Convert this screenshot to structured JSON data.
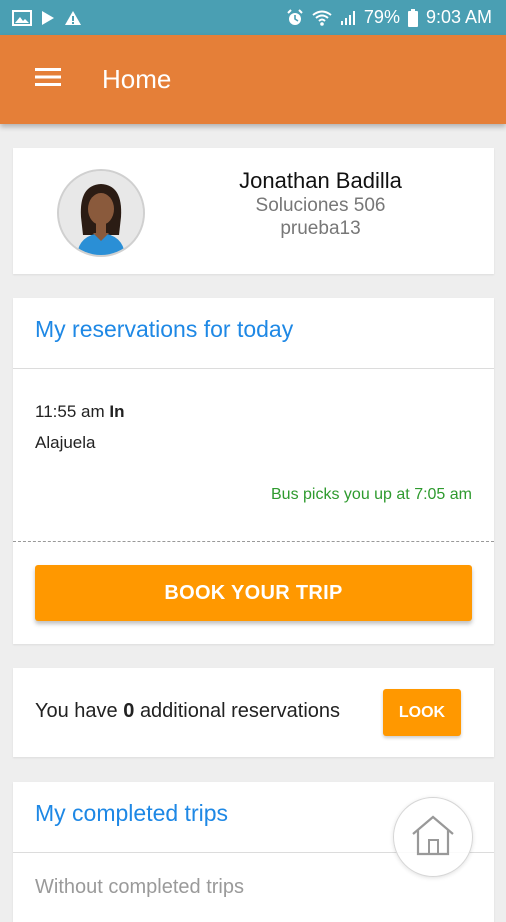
{
  "status_bar": {
    "battery": "79%",
    "time": "9:03 AM",
    "icons_left": [
      "gallery-icon",
      "play-store-icon",
      "warning-icon"
    ],
    "icons_right": [
      "alarm-icon",
      "wifi-icon",
      "signal-icon",
      "battery-icon"
    ],
    "color": "#4a9fb3"
  },
  "app_bar": {
    "title": "Home",
    "color": "#e57f38",
    "menu_icon": "hamburger-menu-icon"
  },
  "profile": {
    "name": "Jonathan Badilla",
    "company": "Soluciones 506",
    "username": "prueba13"
  },
  "reservations": {
    "title": "My reservations for today",
    "items": [
      {
        "time": "11:55 am",
        "direction": "In",
        "place": "Alajuela",
        "pickup_text": "Bus picks you up at 7:05 am"
      }
    ],
    "book_button": "BOOK YOUR TRIP"
  },
  "additional": {
    "prefix": "You have",
    "count": "0",
    "suffix": "additional reservations",
    "look_button": "LOOK"
  },
  "completed": {
    "title": "My completed trips",
    "empty_text": "Without completed trips"
  },
  "colors": {
    "accent_orange": "#ff9800",
    "title_blue": "#1e88e5",
    "pickup_green": "#2e9a2e"
  }
}
